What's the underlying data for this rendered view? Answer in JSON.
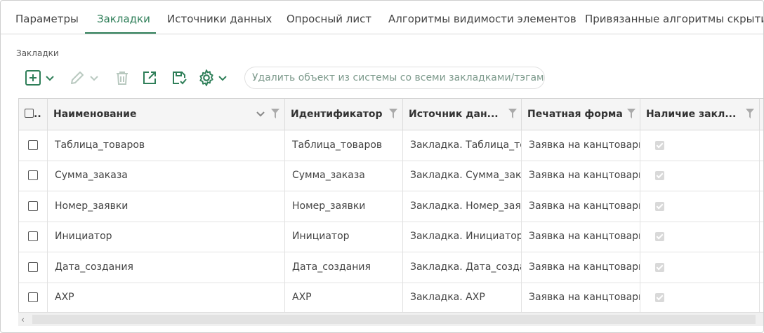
{
  "tabs": [
    {
      "label": "Параметры",
      "active": false
    },
    {
      "label": "Закладки",
      "active": true
    },
    {
      "label": "Источники данных",
      "active": false
    },
    {
      "label": "Опросный лист",
      "active": false
    },
    {
      "label": "Алгоритмы видимости элементов",
      "active": false
    },
    {
      "label": "Привязанные алгоритмы скрытия",
      "active": false
    }
  ],
  "section_label": "Закладки",
  "toolbar": {
    "hint": "Удалить объект из системы со всеми закладками/тэгами",
    "accent_color": "#2f7f59",
    "disabled_color": "#b9c9c0",
    "icons": [
      "add-icon",
      "chevron-down-icon",
      "pencil-icon",
      "trash-icon",
      "export-icon",
      "save-check-icon",
      "gear-icon"
    ]
  },
  "table": {
    "select_all_label": "..",
    "columns": [
      "Наименование",
      "Идентификатор",
      "Источник дан...",
      "Печатная форма",
      "Наличие закл..."
    ],
    "rows": [
      {
        "name": "Таблица_товаров",
        "id": "Таблица_товаров",
        "source": "Закладка. Таблица_товаров",
        "form": "Заявка на канцтовары_",
        "has_bookmark": true
      },
      {
        "name": "Сумма_заказа",
        "id": "Сумма_заказа",
        "source": "Закладка. Сумма_заказа",
        "form": "Заявка на канцтовары_",
        "has_bookmark": true
      },
      {
        "name": "Номер_заявки",
        "id": "Номер_заявки",
        "source": "Закладка. Номер_заявки",
        "form": "Заявка на канцтовары_",
        "has_bookmark": true
      },
      {
        "name": "Инициатор",
        "id": "Инициатор",
        "source": "Закладка. Инициатор",
        "form": "Заявка на канцтовары_",
        "has_bookmark": true
      },
      {
        "name": "Дата_создания",
        "id": "Дата_создания",
        "source": "Закладка. Дата_создания",
        "form": "Заявка на канцтовары_",
        "has_bookmark": true
      },
      {
        "name": "АХР",
        "id": "АХР",
        "source": "Закладка. АХР",
        "form": "Заявка на канцтовары_",
        "has_bookmark": true
      }
    ]
  }
}
